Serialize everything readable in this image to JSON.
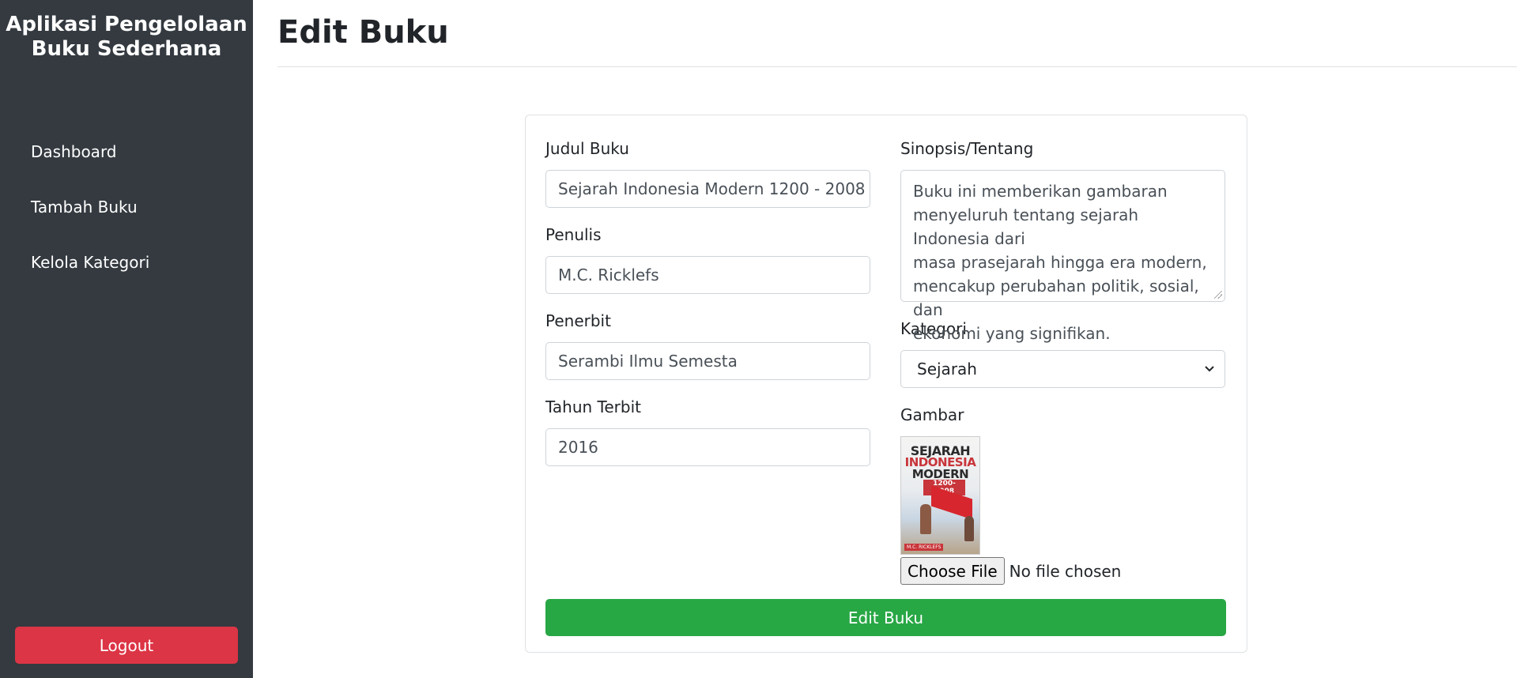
{
  "sidebar": {
    "brand_line1": "Aplikasi Pengelolaan",
    "brand_line2": "Buku Sederhana",
    "items": [
      {
        "label": "Dashboard"
      },
      {
        "label": "Tambah Buku"
      },
      {
        "label": "Kelola Kategori"
      }
    ],
    "logout_label": "Logout"
  },
  "page": {
    "title": "Edit Buku"
  },
  "form": {
    "judul": {
      "label": "Judul Buku",
      "value": "Sejarah Indonesia Modern 1200 - 2008"
    },
    "penulis": {
      "label": "Penulis",
      "value": "M.C. Ricklefs"
    },
    "penerbit": {
      "label": "Penerbit",
      "value": "Serambi Ilmu Semesta"
    },
    "tahun": {
      "label": "Tahun Terbit",
      "value": "2016"
    },
    "sinopsis": {
      "label": "Sinopsis/Tentang",
      "lines": [
        "Buku ini memberikan gambaran",
        "menyeluruh tentang sejarah Indonesia dari",
        "masa prasejarah hingga era modern,",
        "mencakup perubahan politik, sosial, dan",
        "ekonomi yang signifikan."
      ]
    },
    "kategori": {
      "label": "Kategori",
      "selected": "Sejarah"
    },
    "gambar": {
      "label": "Gambar",
      "cover": {
        "line1": "SEJARAH",
        "line2": "INDONESIA",
        "line3": "MODERN",
        "line4": "1200-2008",
        "author": "M.C. RICKLEFS"
      },
      "choose_file_label": "Choose File",
      "file_status": "No file chosen"
    },
    "submit_label": "Edit Buku"
  },
  "colors": {
    "sidebar_bg": "#343a40",
    "logout_bg": "#dc3545",
    "submit_bg": "#28a745"
  }
}
